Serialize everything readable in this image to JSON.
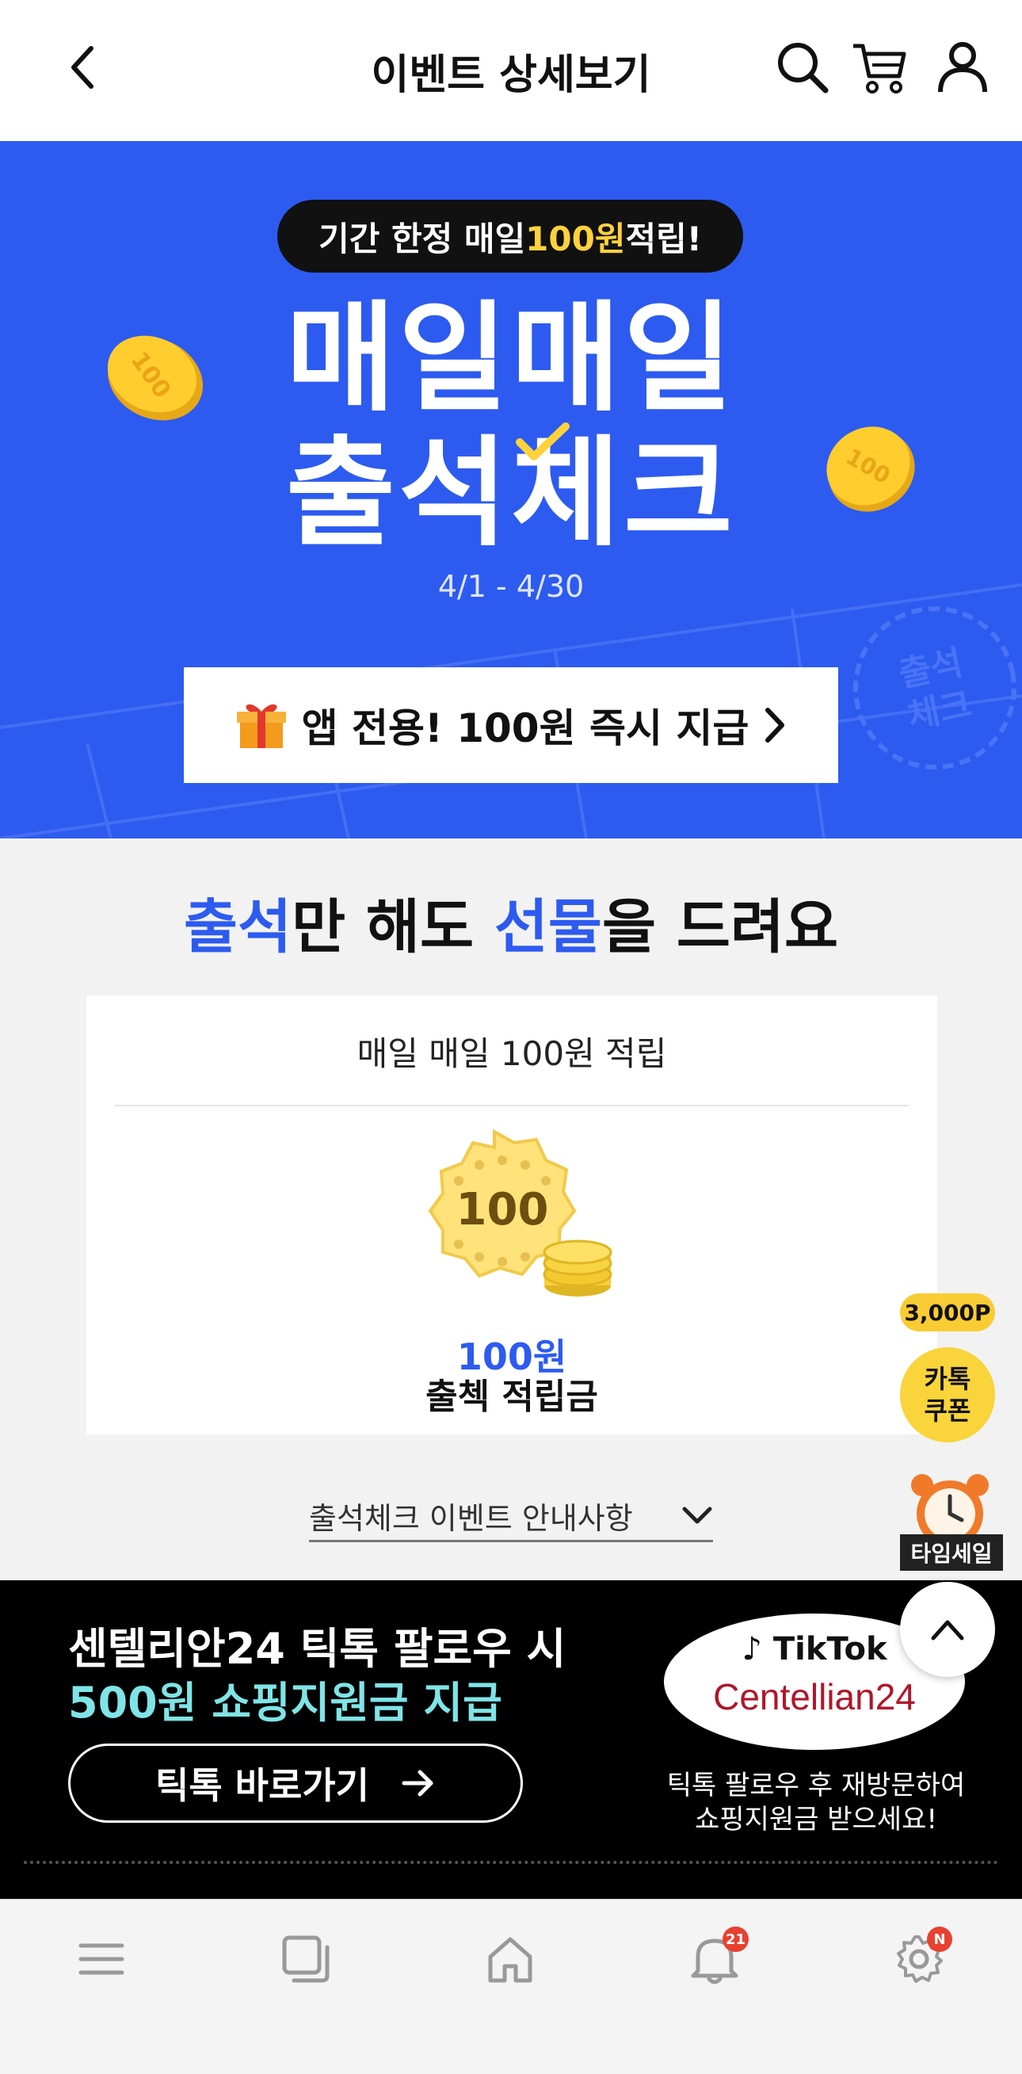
{
  "header": {
    "title": "이벤트 상세보기",
    "back_icon": "chevron-left-icon",
    "search_icon": "search-icon",
    "cart_icon": "cart-icon",
    "account_icon": "user-icon"
  },
  "banner": {
    "pill_text_pre": "기간 한정 매일 ",
    "pill_text_highlight": "100원",
    "pill_text_post": " 적립!",
    "title_line1": "매일매일",
    "title_line2": "출석체크",
    "date_range": "4/1 - 4/30",
    "app_button_label": "앱 전용! 100원 즉시 지급",
    "coin_label": "100",
    "stamp_text": "출석\n체크",
    "colors": {
      "background": "#2d5bf0",
      "pill_highlight": "#ffd23c"
    }
  },
  "gift_section": {
    "heading_part1": "출석",
    "heading_part2": "만 해도 ",
    "heading_part3": "선물",
    "heading_part4": "을 드려요",
    "card_title": "매일 매일 100원 적립",
    "badge_value": "100",
    "amount": "100원",
    "description": "출첵 적립금"
  },
  "notice": {
    "label": "출석체크 이벤트 안내사항"
  },
  "floating": {
    "points_badge": "3,000P",
    "kakao_line1": "카톡",
    "kakao_line2": "쿠폰",
    "time_sale_label": "타임세일"
  },
  "tiktok": {
    "line1": "센텔리안24 틱톡 팔로우 시",
    "line2": "500원 쇼핑지원금 지급",
    "button_label": "틱톡 바로가기",
    "logo_top": "TikTok",
    "logo_brand": "Centellian24",
    "sub_line1": "틱톡 팔로우 후 재방문하여",
    "sub_line2": "쇼핑지원금 받으세요!"
  },
  "bottom_nav": {
    "items": [
      {
        "icon": "menu-icon"
      },
      {
        "icon": "recent-icon"
      },
      {
        "icon": "home-icon"
      },
      {
        "icon": "bell-icon",
        "badge": "21"
      },
      {
        "icon": "gear-icon",
        "badge": "N"
      }
    ]
  }
}
